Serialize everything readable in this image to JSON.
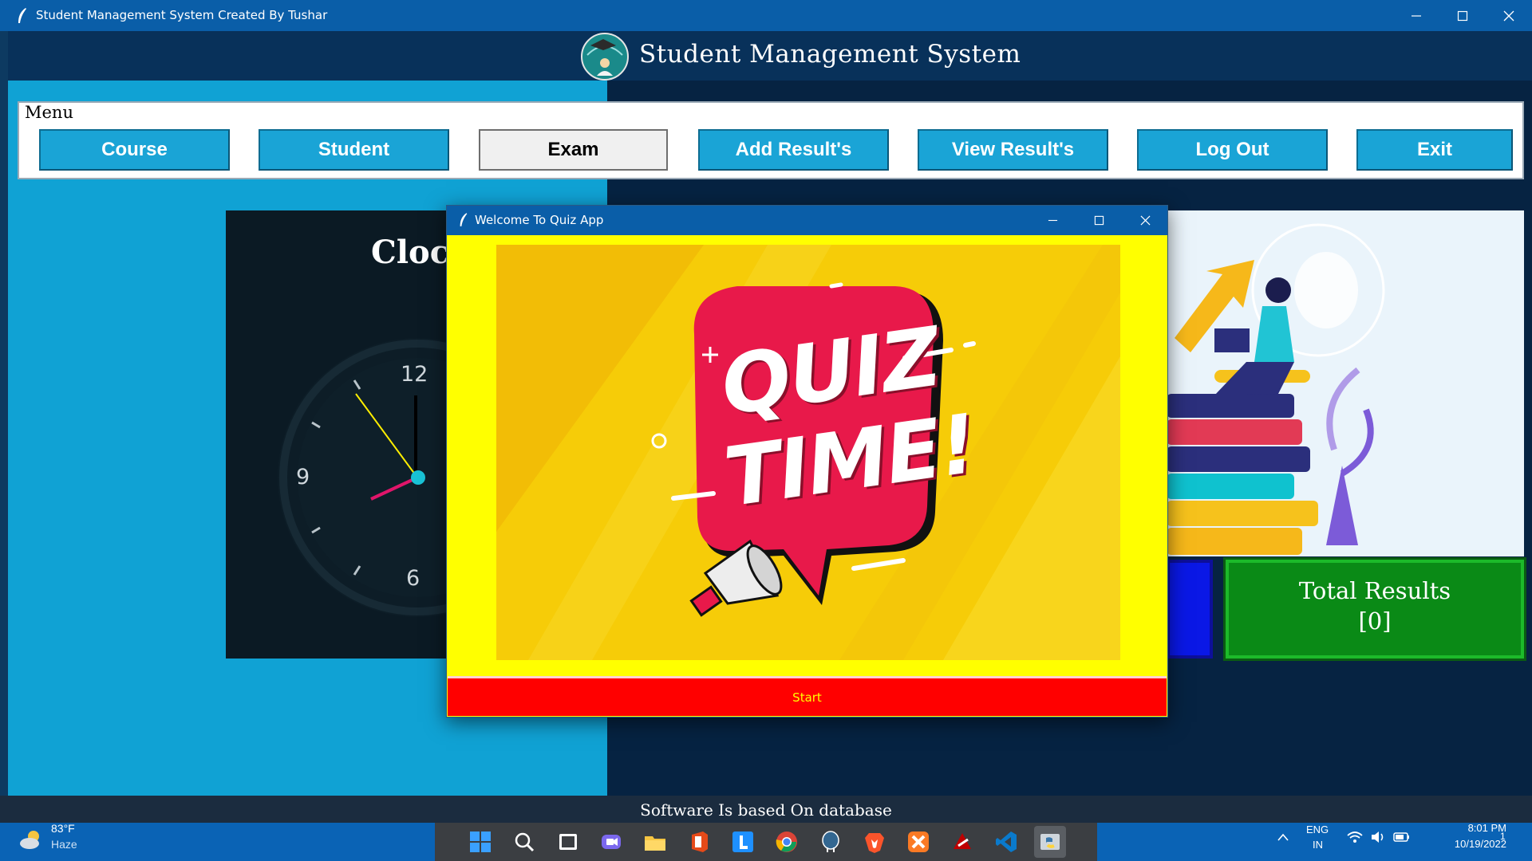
{
  "window": {
    "title": "Student Management System Created By Tushar",
    "minimize_icon": "minimize-icon",
    "maximize_icon": "maximize-icon",
    "close_icon": "close-icon"
  },
  "header": {
    "title": "Student Management System",
    "logo_icon": "graduate-globe-logo"
  },
  "menu": {
    "legend": "Menu",
    "buttons": [
      {
        "label": "Course"
      },
      {
        "label": "Student"
      },
      {
        "label": "Exam",
        "active": true
      },
      {
        "label": "Add Result's"
      },
      {
        "label": "View Result's"
      },
      {
        "label": "Log Out"
      },
      {
        "label": "Exit"
      }
    ]
  },
  "clock": {
    "title": "Clock",
    "numerals": [
      "12",
      "9",
      "6"
    ]
  },
  "results_card": {
    "label": "Total Results",
    "value": "[0]"
  },
  "status_bar": {
    "text": "Software Is based On database"
  },
  "quiz_dialog": {
    "title": "Welcome To Quiz App",
    "image_text_line1": "QUIZ",
    "image_text_line2": "TIME!",
    "start_label": "Start"
  },
  "taskbar": {
    "weather_temp": "83°F",
    "weather_desc": "Haze",
    "lang_line1": "ENG",
    "lang_line2": "IN",
    "time": "8:01 PM",
    "date": "10/19/2022",
    "notification_count": "1",
    "apps": [
      "windows-start-icon",
      "search-icon",
      "task-view-icon",
      "chat-icon",
      "file-explorer-icon",
      "office-icon",
      "l-app-icon",
      "chrome-icon",
      "postgres-icon",
      "brave-icon",
      "xampp-icon",
      "filezilla-icon",
      "vscode-icon",
      "python-app-icon"
    ]
  },
  "colors": {
    "titlebar": "#0a5ea8",
    "menu_button": "#1aa4d6",
    "quiz_bg": "#ffff00",
    "start_button": "#ff0000",
    "results_card": "#0a8a16"
  }
}
